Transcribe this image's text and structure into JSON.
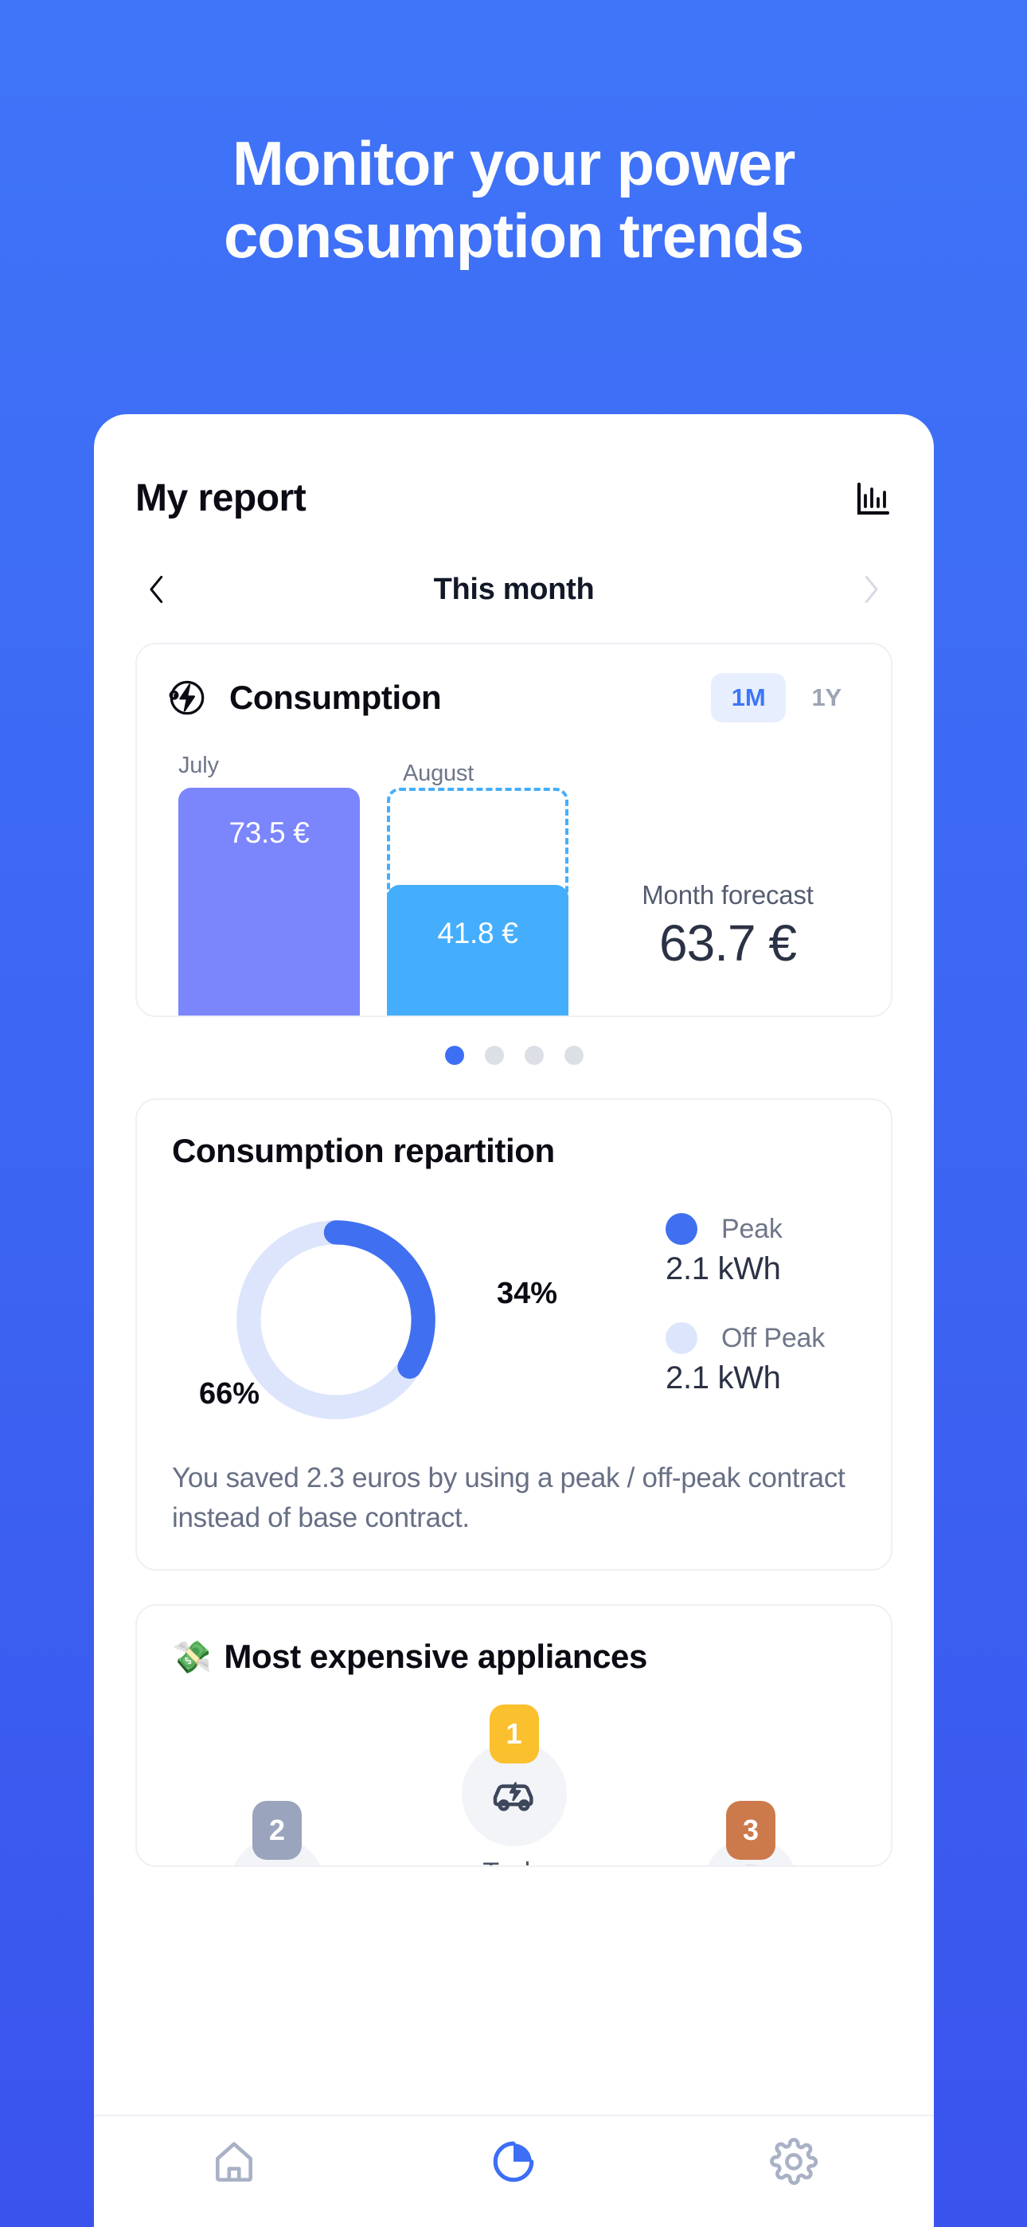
{
  "hero": {
    "line1": "Monitor your power",
    "line2": "consumption trends"
  },
  "app": {
    "header": {
      "title": "My report",
      "chart_icon": "bar-chart-icon"
    },
    "month_nav": {
      "prev_icon": "chevron-left-icon",
      "next_icon": "chevron-right-icon",
      "label": "This month"
    },
    "consumption_card": {
      "icon": "lightning-bolt-circle-icon",
      "title": "Consumption",
      "ranges": [
        {
          "label": "1M",
          "active": true
        },
        {
          "label": "1Y",
          "active": false
        }
      ],
      "forecast_label": "Month forecast",
      "forecast_value": "63.7 €"
    },
    "carousel": {
      "dots": 4,
      "active_index": 0
    },
    "repartition_card": {
      "title": "Consumption repartition",
      "pct_peak": "34%",
      "pct_offpeak": "66%",
      "legend": [
        {
          "name": "Peak",
          "value": "2.1 kWh",
          "color": "#4070F0"
        },
        {
          "name": "Off Peak",
          "value": "2.1 kWh",
          "color": "#DCE5FB"
        }
      ],
      "saved_text": "You saved 2.3 euros by using a peak / off-peak contract instead of base contract."
    },
    "appliances_card": {
      "emoji": "💸",
      "title": "Most expensive appliances",
      "items": [
        {
          "rank": "2",
          "name": "",
          "icon": "oven-icon",
          "badge_color": "#9AA4BC"
        },
        {
          "rank": "1",
          "name": "Tesla",
          "icon": "electric-car-icon",
          "badge_color": "#FBC02D"
        },
        {
          "rank": "3",
          "name": "",
          "icon": "water-heater-icon",
          "badge_color": "#CC7A4C"
        }
      ]
    },
    "bottom_nav": [
      {
        "icon": "home-icon",
        "active": false
      },
      {
        "icon": "pie-chart-icon",
        "active": true
      },
      {
        "icon": "gear-icon",
        "active": false
      }
    ]
  },
  "chart_data": [
    {
      "type": "bar",
      "title": "Consumption",
      "categories": [
        "July",
        "August"
      ],
      "values": [
        73.5,
        41.8
      ],
      "value_labels": [
        "73.5 €",
        "41.8 €"
      ],
      "forecast": 63.7,
      "forecast_label": "Month forecast",
      "unit": "€",
      "series": [
        {
          "name": "July",
          "value": 73.5,
          "color": "#7B85FC"
        },
        {
          "name": "August",
          "value": 41.8,
          "color": "#45AEFC"
        }
      ],
      "annotations": [
        "dashed forecast outline above August bar"
      ],
      "grid": false,
      "legend": "none"
    },
    {
      "type": "pie",
      "title": "Consumption repartition",
      "categories": [
        "Peak",
        "Off Peak"
      ],
      "values": [
        34,
        66
      ],
      "value_labels": [
        "34%",
        "66%"
      ],
      "data_labels": [
        "2.1 kWh",
        "2.1 kWh"
      ],
      "colors": [
        "#4070F0",
        "#DCE5FB"
      ],
      "legend": "right",
      "donut": true
    }
  ],
  "colors": {
    "background_top": "#3F74F8",
    "background_bottom": "#3A53ED",
    "accent": "#3D76F8",
    "july_bar": "#7B85FC",
    "august_bar": "#45AEFC",
    "peak": "#4070F0",
    "offpeak": "#DCE5FB"
  }
}
